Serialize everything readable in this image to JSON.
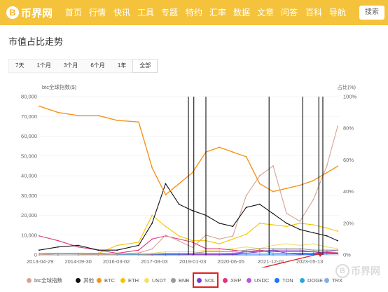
{
  "header": {
    "logo_mark": "B",
    "logo_text": "币界网",
    "nav": [
      "首页",
      "行情",
      "快讯",
      "工具",
      "专题",
      "特约",
      "汇率",
      "数据",
      "文章",
      "问答",
      "百科",
      "导航"
    ],
    "active_nav": "行情",
    "search_label": "搜索"
  },
  "page_title": "市值占比走势",
  "ranges": [
    "7天",
    "1个月",
    "3个月",
    "6个月",
    "1年",
    "全部"
  ],
  "active_range": "全部",
  "watermark": "币界网",
  "colors": {
    "brand": "#f5c33b",
    "btc_index": "#d4a494",
    "others": "#111111",
    "btc": "#f7931a",
    "eth": "#f5c400",
    "usdt": "#f2e06b",
    "bnb": "#999999",
    "sol": "#7b3fc8",
    "xrp": "#e0357b",
    "usdc": "#b65ad6",
    "ton": "#1677ff",
    "doge": "#2aa8e0",
    "trx": "#7fb0e8",
    "highlight": "#e02020"
  },
  "chart_data": {
    "type": "line",
    "left_axis_label": "btc全球指数($)",
    "right_axis_label": "占比(%)",
    "left_ticks": [
      "0",
      "10,000",
      "20,000",
      "30,000",
      "40,000",
      "50,000",
      "60,000",
      "70,000",
      "80,000"
    ],
    "right_ticks": [
      "0%",
      "20%",
      "40%",
      "60%",
      "80%",
      "100%"
    ],
    "x_ticks": [
      "2013-04-29",
      "2014-09-30",
      "2016-03-02",
      "2017-08-03",
      "2019-01-03",
      "2020-06-05",
      "2021-12-01",
      "2023-05-13"
    ],
    "ylim_left": [
      0,
      80000
    ],
    "ylim_right": [
      0,
      100
    ],
    "x": [
      2013.3,
      2014.0,
      2014.75,
      2015.5,
      2016.2,
      2017.0,
      2017.5,
      2018.0,
      2018.5,
      2019.0,
      2019.5,
      2020.0,
      2020.5,
      2021.0,
      2021.5,
      2022.0,
      2022.5,
      2023.0,
      2023.5,
      2024.0,
      2024.4
    ],
    "series": [
      {
        "name": "btc全球指数",
        "axis": "left",
        "values": [
          150,
          600,
          500,
          300,
          450,
          1000,
          3000,
          10000,
          7000,
          3800,
          10000,
          8000,
          9500,
          30000,
          40000,
          45000,
          21000,
          17000,
          28000,
          45000,
          65000
        ]
      },
      {
        "name": "其他",
        "axis": "right",
        "values": [
          3,
          5,
          6,
          3,
          3,
          6,
          20,
          45,
          32,
          28,
          25,
          20,
          18,
          30,
          32,
          26,
          20,
          16,
          14,
          12,
          9
        ]
      },
      {
        "name": "BTC",
        "axis": "right",
        "values": [
          94,
          90,
          88,
          88,
          85,
          84,
          55,
          38,
          45,
          52,
          65,
          68,
          65,
          62,
          45,
          40,
          42,
          44,
          47,
          52,
          56
        ]
      },
      {
        "name": "ETH",
        "axis": "right",
        "values": [
          0,
          0,
          0,
          1,
          6,
          8,
          25,
          18,
          12,
          9,
          9,
          7,
          10,
          13,
          20,
          19,
          18,
          20,
          19,
          17,
          15
        ]
      },
      {
        "name": "USDT",
        "axis": "right",
        "values": [
          0,
          0,
          0,
          0,
          0,
          0.5,
          1,
          2,
          2,
          2,
          3,
          3,
          4,
          5,
          4,
          6,
          7,
          6,
          7,
          5,
          4
        ]
      },
      {
        "name": "BNB",
        "axis": "right",
        "values": [
          0,
          0,
          0,
          0,
          0,
          0,
          0.5,
          1,
          1,
          1,
          2,
          2,
          2,
          3,
          4,
          4,
          4,
          4,
          3,
          3,
          3
        ]
      },
      {
        "name": "SOL",
        "axis": "right",
        "values": [
          0,
          0,
          0,
          0,
          0,
          0,
          0,
          0,
          0,
          0,
          0,
          0,
          0.2,
          1,
          2,
          3,
          1,
          0.5,
          1,
          2,
          3
        ]
      },
      {
        "name": "XRP",
        "axis": "right",
        "values": [
          12,
          9,
          5,
          3,
          1,
          3,
          10,
          12,
          10,
          8,
          4,
          4,
          3,
          2,
          3,
          2,
          2,
          2,
          2,
          1.5,
          1.3
        ]
      },
      {
        "name": "USDC",
        "axis": "right",
        "values": [
          0,
          0,
          0,
          0,
          0,
          0,
          0,
          0,
          0,
          0.2,
          0.5,
          0.5,
          1,
          2,
          2,
          3,
          3,
          3,
          2,
          1.5,
          1.3
        ]
      },
      {
        "name": "TON",
        "axis": "right",
        "values": [
          0,
          0,
          0,
          0,
          0,
          0,
          0,
          0,
          0,
          0,
          0,
          0,
          0,
          0,
          0,
          0,
          0,
          0,
          0.3,
          0.6,
          0.7
        ]
      },
      {
        "name": "DOGE",
        "axis": "right",
        "values": [
          1,
          1,
          1,
          1,
          0.5,
          0.5,
          0.5,
          0.5,
          0.5,
          0.5,
          0.5,
          0.5,
          0.5,
          2,
          3,
          1,
          1,
          1,
          0.8,
          0.8,
          0.9
        ]
      },
      {
        "name": "TRX",
        "axis": "right",
        "values": [
          0,
          0,
          0,
          0,
          0,
          0,
          0.5,
          1,
          1,
          1,
          1,
          1,
          1,
          1,
          1,
          1,
          1,
          1,
          1,
          0.8,
          0.8
        ]
      }
    ],
    "event_markers": [
      2018.85,
      2019.05,
      2019.5,
      2021.85,
      2023.1,
      2023.7,
      2023.85
    ],
    "legend": [
      "btc全球指数",
      "其他",
      "BTC",
      "ETH",
      "USDT",
      "BNB",
      "SOL",
      "XRP",
      "USDC",
      "TON",
      "DOGE",
      "TRX"
    ],
    "highlighted_legend": "SOL",
    "legend_placement": "bottom",
    "grid": true
  }
}
